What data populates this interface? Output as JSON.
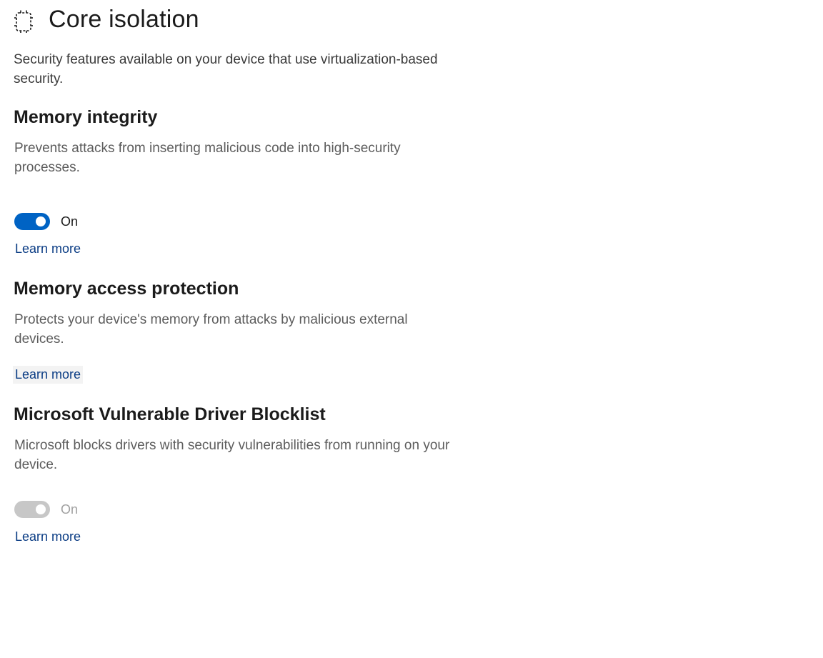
{
  "header": {
    "icon": "core-isolation-chip-icon",
    "title": "Core isolation",
    "description": "Security features available on your device that use virtualization-based security."
  },
  "sections": [
    {
      "title": "Memory integrity",
      "description": "Prevents attacks from inserting malicious code into high-security processes.",
      "toggle": {
        "state": "on",
        "label": "On",
        "enabled": true
      },
      "link": "Learn more"
    },
    {
      "title": "Memory access protection",
      "description": "Protects your device's memory from attacks by malicious external devices.",
      "link": "Learn more"
    },
    {
      "title": "Microsoft Vulnerable Driver Blocklist",
      "description": "Microsoft blocks drivers with security vulnerabilities from running on your device.",
      "toggle": {
        "state": "on",
        "label": "On",
        "enabled": false
      },
      "link": "Learn more"
    }
  ],
  "colors": {
    "accent": "#0063c4",
    "link": "#0a3c84",
    "disabled": "#c7c7c7"
  }
}
